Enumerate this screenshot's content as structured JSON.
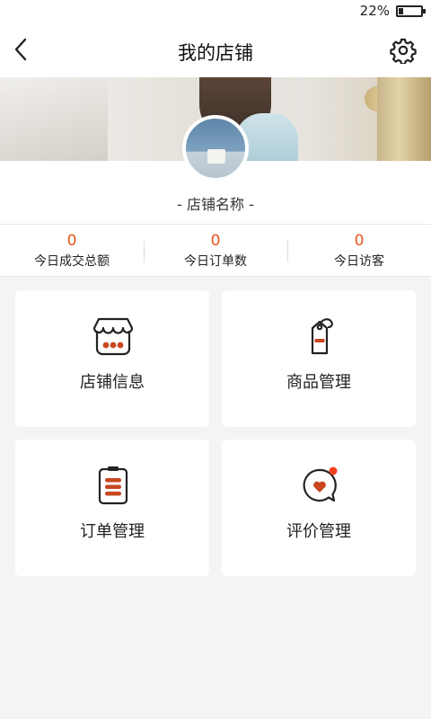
{
  "status_bar": {
    "battery_text": "22%",
    "battery_level": 0.22
  },
  "nav": {
    "title": "我的店铺"
  },
  "store": {
    "name": "- 店铺名称 -"
  },
  "stats": [
    {
      "value": "0",
      "label": "今日成交总额"
    },
    {
      "value": "0",
      "label": "今日订单数"
    },
    {
      "value": "0",
      "label": "今日访客"
    }
  ],
  "menu": [
    {
      "label": "店铺信息",
      "icon": "store-icon"
    },
    {
      "label": "商品管理",
      "icon": "price-tag-icon"
    },
    {
      "label": "订单管理",
      "icon": "clipboard-icon"
    },
    {
      "label": "评价管理",
      "icon": "heart-comment-icon"
    }
  ],
  "colors": {
    "accent": "#e8541e",
    "icon_fill": "#c8471f",
    "badge": "#f0421e"
  }
}
